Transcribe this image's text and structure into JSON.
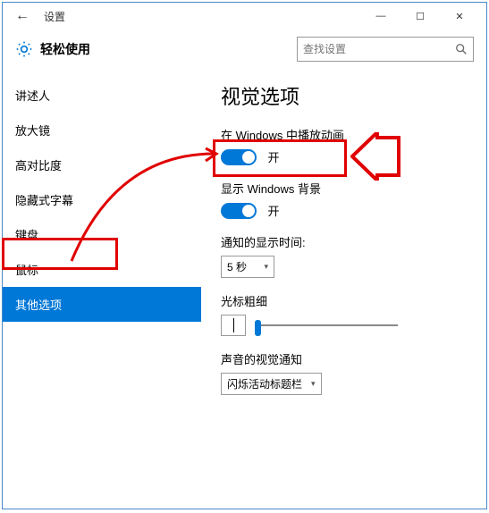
{
  "window": {
    "title": "设置",
    "controls": {
      "min": "—",
      "max": "☐",
      "close": "✕"
    }
  },
  "header": {
    "title": "轻松使用",
    "search_placeholder": "查找设置"
  },
  "sidebar": {
    "items": [
      {
        "label": "讲述人"
      },
      {
        "label": "放大镜"
      },
      {
        "label": "高对比度"
      },
      {
        "label": "隐藏式字幕"
      },
      {
        "label": "键盘"
      },
      {
        "label": "鼠标"
      },
      {
        "label": "其他选项"
      }
    ],
    "selected_index": 6
  },
  "content": {
    "page_title": "视觉选项",
    "animations": {
      "label": "在 Windows 中播放动画",
      "state": "开"
    },
    "background": {
      "label": "显示 Windows 背景",
      "state": "开"
    },
    "notification_time": {
      "label": "通知的显示时间:",
      "value": "5 秒"
    },
    "cursor": {
      "label": "光标粗细"
    },
    "sound_visual": {
      "label": "声音的视觉通知",
      "value": "闪烁活动标题栏"
    }
  }
}
